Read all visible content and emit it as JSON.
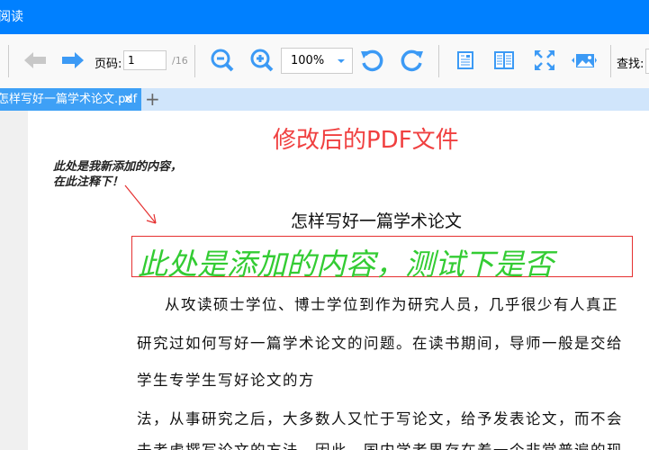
{
  "app": {
    "title": "阅读"
  },
  "toolbar": {
    "page_label": "页码:",
    "page_value": "1",
    "page_total": "/16",
    "zoom": "100%",
    "find_label": "查找:"
  },
  "tabs": [
    {
      "label": "怎样写好一篇学术论文.pdf",
      "close": "×"
    }
  ],
  "add_tab": "+",
  "document": {
    "heading": "修改后的PDF文件",
    "annotation_note": "此处是我新添加的内容，在此注释下！",
    "title": "怎样写好一篇学术论文",
    "inserted_text": "此处是添加的内容，测试下是否",
    "paragraphs": [
      "从攻读硕士学位、博士学位到作为研究人员，几乎很少有人真正",
      "研究过如何写好一篇学术论文的问题。在读书期间，导师一般是交给",
      "学生专学生写好论文的方",
      "法，从事研究之后，大多数人又忙于写论文，给予发表论文，而不会",
      "去考虑撰写论文的方法。因此，国内学者界存在着一个非常普遍的现"
    ]
  },
  "colors": {
    "titlebar": "#0080ff",
    "accent": "#3c9af5",
    "heading": "#f04040",
    "inserted": "#33cc33"
  }
}
